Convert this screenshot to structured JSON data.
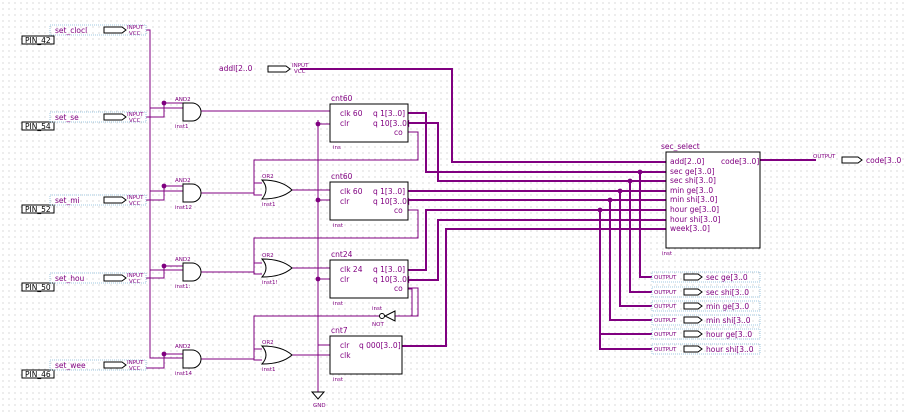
{
  "pins": [
    {
      "name": "set_clock",
      "label": "set_clocl",
      "pin": "PIN_42",
      "type": "INPUT",
      "vcc": "VCC"
    },
    {
      "name": "set_sec",
      "label": "set_se",
      "pin": "PIN_54",
      "type": "INPUT",
      "vcc": "VCC"
    },
    {
      "name": "set_min",
      "label": "set_mi",
      "pin": "PIN_52",
      "type": "INPUT",
      "vcc": "VCC"
    },
    {
      "name": "set_hour",
      "label": "set_hou",
      "pin": "PIN_50",
      "type": "INPUT",
      "vcc": "VCC"
    },
    {
      "name": "set_week",
      "label": "set_wee",
      "pin": "PIN_46",
      "type": "INPUT",
      "vcc": "VCC"
    }
  ],
  "addr_input": {
    "label": "addl[2..0",
    "type": "INPUT",
    "vcc": "VCC"
  },
  "gates": {
    "and_label": "AND2",
    "or_label": "OR2",
    "not_label": "NOT",
    "and_insts": [
      "inst1",
      "inst12",
      "inst1:",
      "inst14"
    ],
    "or_insts": [
      "inst1",
      "inst1!",
      "inst1"
    ],
    "not_inst": "inst"
  },
  "counters": [
    {
      "title": "cnt60",
      "ports_left": [
        "clk  60",
        "clr"
      ],
      "ports_right": [
        "q  1[3..0]",
        "q  10[3..0]",
        "co"
      ],
      "inst": "ins"
    },
    {
      "title": "cnt60",
      "ports_left": [
        "clk  60",
        "clr"
      ],
      "ports_right": [
        "q  1[3..0]",
        "q  10[3..0]",
        "co"
      ],
      "inst": "inst"
    },
    {
      "title": "cnt24",
      "ports_left": [
        "clk  24",
        "clr"
      ],
      "ports_right": [
        "q  1[3..0]",
        "q  10[3..0]",
        "co"
      ],
      "inst": "inst"
    },
    {
      "title": "cnt7",
      "ports_left": [
        "clr",
        "clk"
      ],
      "ports_right": [
        "q  000[3..0]"
      ],
      "inst": "inst"
    }
  ],
  "mux": {
    "title": "sec_select",
    "inputs": [
      "add[2..0]",
      "sec  ge[3..0]",
      "sec  shi[3..0]",
      "min  ge[3..0",
      "min  shi[3..0]",
      "hour ge[3..0]",
      "hour shi[3..0]",
      "week[3..0]"
    ],
    "output": "code[3..0]",
    "inst": "inst"
  },
  "outputs": {
    "type": "OUTPUT",
    "code": "code[3..0",
    "list": [
      "sec  ge[3..0",
      "sec  shi[3..0",
      "min  ge[3..0",
      "min  shi[3..0",
      "hour  ge[3..0",
      "hour  shi[3..0"
    ]
  },
  "gnd": "GND",
  "colors": {
    "bus": "#800080",
    "wire": "#800080",
    "block": "#000000",
    "dot": "#b0b0b0"
  }
}
